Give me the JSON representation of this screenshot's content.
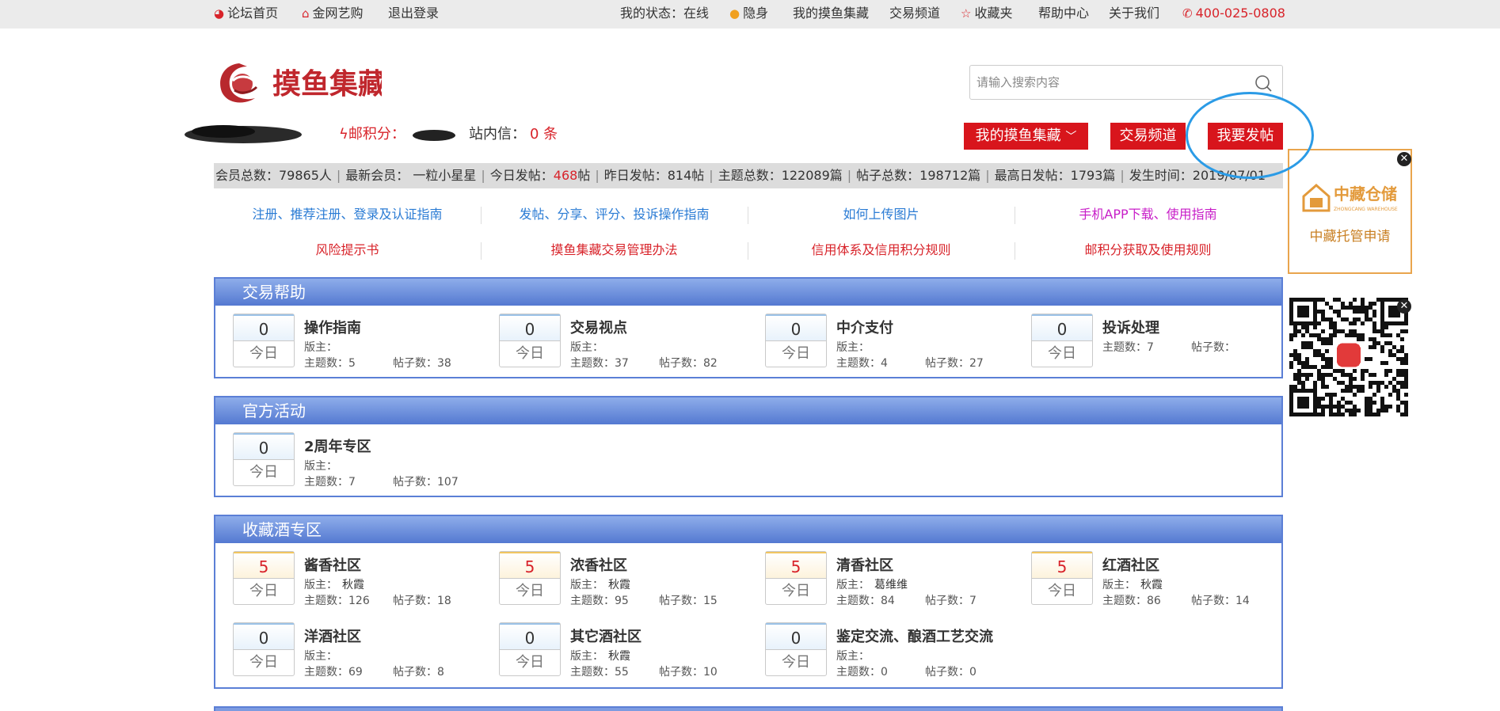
{
  "topbar": {
    "forum_home": "论坛首页",
    "jinwang": "金网艺购",
    "logout": "退出登录",
    "status": "我的状态：在线",
    "invisible": "隐身",
    "my_collection": "我的摸鱼集藏",
    "trade_channel": "交易频道",
    "favorites": "收藏夹",
    "help_center": "帮助中心",
    "about": "关于我们",
    "phone": "400-025-0808"
  },
  "header": {
    "logo_text": "摸鱼集藏",
    "search_placeholder": "请输入搜索内容"
  },
  "user": {
    "points_label": "邮积分：",
    "mail_label": "站内信：",
    "mail_count": "0 条",
    "btn_my_collection": "我的摸鱼集藏",
    "btn_trade": "交易频道",
    "btn_post": "我要发帖"
  },
  "stats": {
    "members": "会员总数：79865人",
    "newest": "最新会员： 一粒小星星",
    "today_prefix": "今日发帖：",
    "today_value": "468",
    "today_suffix": "帖",
    "yesterday": "昨日发帖：814帖",
    "topics": "主题总数：122089篇",
    "posts": "帖子总数：198712篇",
    "max_day": "最高日发帖：1793篇",
    "time": "发生时间：2019/07/01"
  },
  "help_links": [
    {
      "label": "注册、推荐注册、登录及认证指南",
      "color": "#2a7bd4"
    },
    {
      "label": "发帖、分享、评分、投诉操作指南",
      "color": "#2a7bd4"
    },
    {
      "label": "如何上传图片",
      "color": "#2a7bd4"
    },
    {
      "label": "手机APP下载、使用指南",
      "color": "#c81ec8"
    },
    {
      "label": "风险提示书",
      "color": "#d8232a"
    },
    {
      "label": "摸鱼集藏交易管理办法",
      "color": "#d8232a"
    },
    {
      "label": "信用体系及信用积分规则",
      "color": "#d8232a"
    },
    {
      "label": "邮积分获取及使用规则",
      "color": "#d8232a"
    }
  ],
  "sections": [
    {
      "title": "交易帮助",
      "forums": [
        {
          "count": "0",
          "today": "今日",
          "name": "操作指南",
          "mod_label": "版主：",
          "mod": "",
          "topics": "主题数：5",
          "posts": "帖子数：38"
        },
        {
          "count": "0",
          "today": "今日",
          "name": "交易视点",
          "mod_label": "版主：",
          "mod": "",
          "topics": "主题数：37",
          "posts": "帖子数：82"
        },
        {
          "count": "0",
          "today": "今日",
          "name": "中介支付",
          "mod_label": "版主：",
          "mod": "",
          "topics": "主题数：4",
          "posts": "帖子数：27"
        },
        {
          "count": "0",
          "today": "今日",
          "name": "投诉处理",
          "mod_label": "主题数：7",
          "mod": "",
          "topics": "",
          "posts": "帖子数："
        }
      ]
    },
    {
      "title": "官方活动",
      "forums": [
        {
          "count": "0",
          "today": "今日",
          "name": "2周年专区",
          "mod_label": "版主：",
          "mod": "",
          "topics": "主题数：7",
          "posts": "帖子数：107"
        }
      ]
    },
    {
      "title": "收藏酒专区",
      "forums": [
        {
          "count": "5",
          "today": "今日",
          "name": "酱香社区",
          "mod_label": "版主：",
          "mod": "秋霞",
          "topics": "主题数：126",
          "posts": "帖子数：18"
        },
        {
          "count": "5",
          "today": "今日",
          "name": "浓香社区",
          "mod_label": "版主：",
          "mod": "秋霞",
          "topics": "主题数：95",
          "posts": "帖子数：15"
        },
        {
          "count": "5",
          "today": "今日",
          "name": "清香社区",
          "mod_label": "版主：",
          "mod": "葛维维",
          "topics": "主题数：84",
          "posts": "帖子数：7"
        },
        {
          "count": "5",
          "today": "今日",
          "name": "红酒社区",
          "mod_label": "版主：",
          "mod": "秋霞",
          "topics": "主题数：86",
          "posts": "帖子数：14"
        },
        {
          "count": "0",
          "today": "今日",
          "name": "洋酒社区",
          "mod_label": "版主：",
          "mod": "",
          "topics": "主题数：69",
          "posts": "帖子数：8"
        },
        {
          "count": "0",
          "today": "今日",
          "name": "其它酒社区",
          "mod_label": "版主：",
          "mod": "秋霞",
          "topics": "主题数：55",
          "posts": "帖子数：10"
        },
        {
          "count": "0",
          "today": "今日",
          "name": "鉴定交流、酿酒工艺交流",
          "mod_label": "版主：",
          "mod": "",
          "topics": "主题数：0",
          "posts": "帖子数：0"
        }
      ]
    }
  ],
  "sidebar": {
    "zc_brand": "中藏仓储",
    "zc_sub": "ZHONGCANG WAREHOUSE",
    "zc_label": "中藏托管申请",
    "close": "✕"
  },
  "colors": {
    "brand_red": "#d8151c",
    "section_blue": "#5b7fd6",
    "highlight": "#2b9be6"
  }
}
